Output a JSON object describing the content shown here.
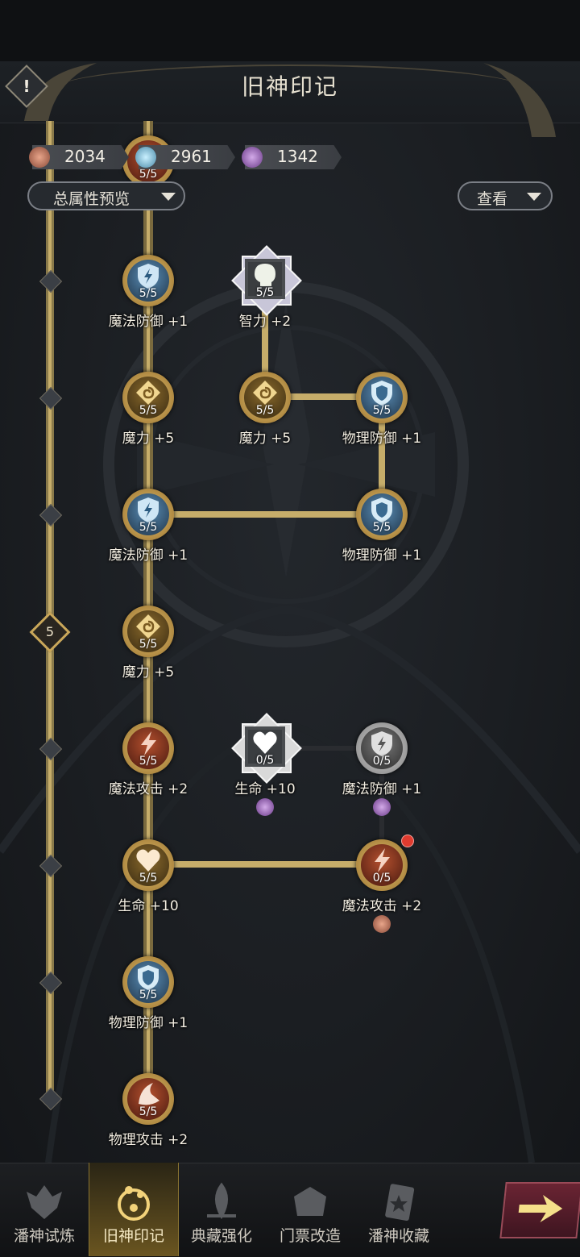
{
  "header": {
    "title": "旧神印记",
    "info_icon": "!"
  },
  "resources": [
    {
      "name": "rose-gem-icon",
      "value": "2034",
      "color": "#c9876b"
    },
    {
      "name": "crystal-gem-icon",
      "value": "2961",
      "color": "#8fc6d8"
    },
    {
      "name": "violet-gem-icon",
      "value": "1342",
      "color": "#a37ab8"
    }
  ],
  "filters": {
    "total_preview": "总属性预览",
    "view": "查看"
  },
  "milestone": "5",
  "nodes": {
    "top_partial": {
      "count": "5/5"
    },
    "r1c1": {
      "label": "魔法防御 +1",
      "count": "5/5"
    },
    "r1c2": {
      "label": "智力 +2",
      "count": "5/5"
    },
    "r2c1": {
      "label": "魔力 +5",
      "count": "5/5"
    },
    "r2c2": {
      "label": "魔力 +5",
      "count": "5/5"
    },
    "r2c3": {
      "label": "物理防御 +1",
      "count": "5/5"
    },
    "r3c1": {
      "label": "魔法防御 +1",
      "count": "5/5"
    },
    "r3c3": {
      "label": "物理防御 +1",
      "count": "5/5"
    },
    "r4c1": {
      "label": "魔力 +5",
      "count": "5/5"
    },
    "r5c1": {
      "label": "魔法攻击 +2",
      "count": "5/5"
    },
    "r5c2": {
      "label": "生命 +10",
      "count": "0/5"
    },
    "r5c3": {
      "label": "魔法防御 +1",
      "count": "0/5"
    },
    "r6c1": {
      "label": "生命 +10",
      "count": "5/5"
    },
    "r6c3": {
      "label": "魔法攻击 +2",
      "count": "0/5"
    },
    "r7c1": {
      "label": "物理防御 +1",
      "count": "5/5"
    },
    "r8c1": {
      "label": "物理攻击 +2",
      "count": "5/5"
    }
  },
  "tabs": [
    {
      "label": "潘神试炼",
      "icon": "trial-icon"
    },
    {
      "label": "旧神印记",
      "icon": "mark-icon",
      "selected": true
    },
    {
      "label": "典藏强化",
      "icon": "enhance-icon"
    },
    {
      "label": "门票改造",
      "icon": "ticket-icon"
    },
    {
      "label": "潘神收藏",
      "icon": "collection-icon"
    }
  ],
  "colors": {
    "gold": "#c9a75a",
    "alert": "#e03b2f",
    "selected_tab": "#6a5520"
  }
}
